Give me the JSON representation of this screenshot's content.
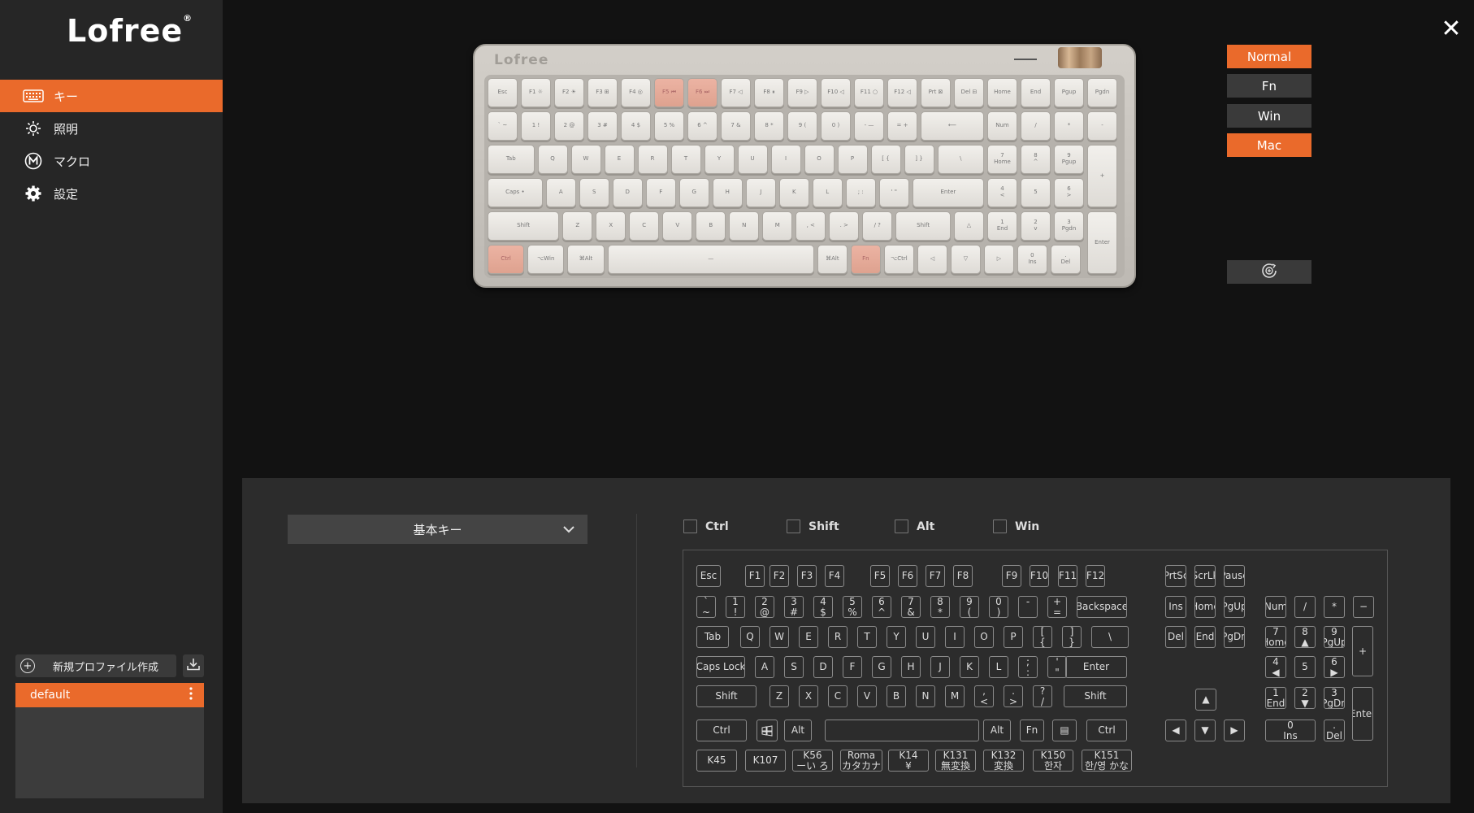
{
  "brand": {
    "logo": "Lofree",
    "mark": "®"
  },
  "sidebar": {
    "items": [
      {
        "label": "キー",
        "icon": "keyboard-icon",
        "active": true
      },
      {
        "label": "照明",
        "icon": "sun-icon",
        "active": false
      },
      {
        "label": "マクロ",
        "icon": "macro-m-icon",
        "active": false
      },
      {
        "label": "設定",
        "icon": "gear-icon",
        "active": false
      }
    ],
    "new_profile_label": "新規プロファイル作成",
    "profiles": [
      {
        "name": "default"
      }
    ]
  },
  "modes": [
    "Normal",
    "Fn",
    "Win",
    "Mac"
  ],
  "active_modes": [
    "Normal",
    "Mac"
  ],
  "keyboard_preview": {
    "logo": "Lofree",
    "rows": [
      [
        "Esc",
        "F1 ☼",
        "F2 ☀",
        "F3 ⊞",
        "F4 ◎",
        "F5 ⏮",
        "F6 ⏭",
        "F7 ◁",
        "F8 ⏸",
        "F9 ▷",
        "F10 ◁",
        "F11 ○",
        "F12 ◁",
        "Prt ⊠",
        "Del ⊟",
        "Home",
        "End",
        "Pgup",
        "Pgdn"
      ],
      [
        "` ~",
        "1 !",
        "2 @",
        "3 #",
        "4 $",
        "5 %",
        "6 ^",
        "7 &",
        "8 *",
        "9 (",
        "0 )",
        "- —",
        "= +",
        "⟵",
        "Num",
        "/",
        "*",
        "-"
      ],
      [
        "Tab",
        "Q",
        "W",
        "E",
        "R",
        "T",
        "Y",
        "U",
        "I",
        "O",
        "P",
        "[ {",
        "] }",
        "\\ |",
        "7|Home",
        "8|^",
        "9|Pgup",
        "+"
      ],
      [
        "Caps •",
        "A",
        "S",
        "D",
        "F",
        "G",
        "H",
        "J",
        "K",
        "L",
        "; :",
        "' \"",
        "Enter",
        "4|<",
        "5",
        "6|>"
      ],
      [
        "Shift",
        "Z",
        "X",
        "C",
        "V",
        "B",
        "N",
        "M",
        ", <",
        ". >",
        "/ ?",
        "Shift",
        "△",
        "1|End",
        "2|v",
        "3|Pgdn",
        "Enter"
      ],
      [
        "Ctrl",
        "⌥Win",
        "⌘Alt",
        "—",
        "⌘Alt",
        "Fn",
        "⌥Ctrl",
        "◁",
        "▽",
        "▷",
        "0|Ins",
        ".|Del"
      ]
    ],
    "highlighted": [
      "F5 ⏮",
      "F6 ⏭",
      "Ctrl",
      "Fn"
    ]
  },
  "assign_panel": {
    "category": "基本キー",
    "modifiers": [
      "Ctrl",
      "Shift",
      "Alt",
      "Win"
    ],
    "rows": {
      "fn": [
        "Esc",
        "F1",
        "F2",
        "F3",
        "F4",
        "F5",
        "F6",
        "F7",
        "F8",
        "F9",
        "F10",
        "F11",
        "F12"
      ],
      "nav_top": [
        "PrtSc",
        "ScrLk",
        "Pause"
      ],
      "number": [
        "`|~",
        "1|!",
        "2|@",
        "3|#",
        "4|$",
        "5|%",
        "6|^",
        "7|&",
        "8|*",
        "9|(",
        "0|)",
        "-|_",
        "+|=",
        "Backspace"
      ],
      "nav_mid1": [
        "Ins",
        "Home",
        "PgUp"
      ],
      "num_top": [
        "Num",
        "/",
        "*",
        "−"
      ],
      "tab": [
        "Tab",
        "Q",
        "W",
        "E",
        "R",
        "T",
        "Y",
        "U",
        "I",
        "O",
        "P",
        "[|{",
        "]|}",
        "\\||"
      ],
      "nav_mid2": [
        "Del",
        "End",
        "PgDn"
      ],
      "num_r2": [
        "7|Home",
        "8|▲",
        "9|PgUp",
        "+"
      ],
      "caps": [
        "Caps Lock",
        "A",
        "S",
        "D",
        "F",
        "G",
        "H",
        "J",
        "K",
        "L",
        ";|:",
        "'|\"",
        "Enter"
      ],
      "num_r3": [
        "4|◀",
        "5",
        "6|▶"
      ],
      "shift": [
        "Shift",
        "Z",
        "X",
        "C",
        "V",
        "B",
        "N",
        "M",
        ",|<",
        ".|>",
        "?|/",
        "Shift"
      ],
      "arrow_up": "▲",
      "num_r4": [
        "1|End",
        "2|▼",
        "3|PgDn",
        "Enter"
      ],
      "ctrl": [
        "Ctrl",
        "⊞",
        "Alt",
        "",
        "Alt",
        "Fn",
        "▤",
        "Ctrl"
      ],
      "arrows": [
        "◀",
        "▼",
        "▶"
      ],
      "num_r5": [
        "0|Ins",
        ".|Del"
      ],
      "extra": [
        "K45",
        "K107",
        "K56|ーい ろ",
        "Roma|カタカナ",
        "K14||  ¥",
        "K131|無変換",
        "K132|変換",
        "K150|한자",
        "K151|한/영 かな"
      ]
    }
  }
}
